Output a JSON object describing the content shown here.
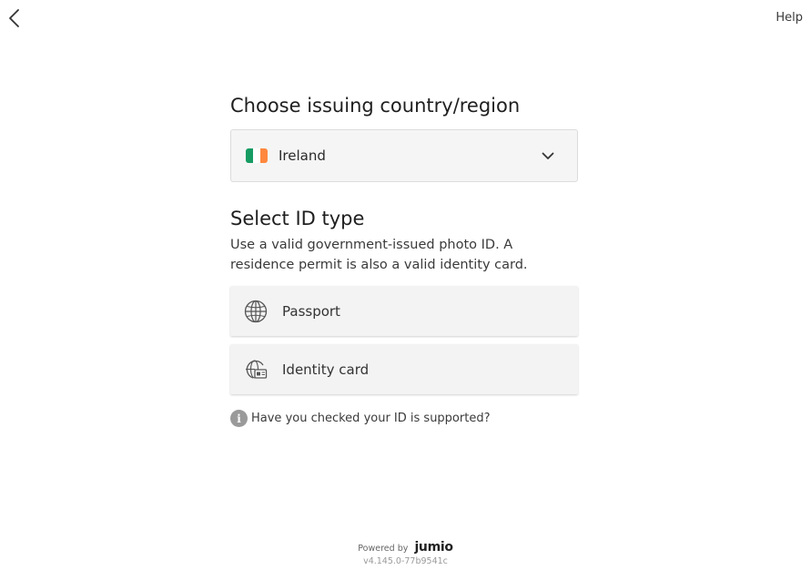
{
  "header": {
    "help_label": "Help"
  },
  "country": {
    "title": "Choose issuing country/region",
    "selected": "Ireland",
    "flag_colors": [
      "#169b62",
      "#ffffff",
      "#ff883e"
    ]
  },
  "id_type": {
    "title": "Select ID type",
    "description": "Use a valid government-issued photo ID. A residence permit is also a valid identity card.",
    "options": [
      {
        "label": "Passport",
        "icon": "globe-icon"
      },
      {
        "label": "Identity card",
        "icon": "id-card-icon"
      }
    ]
  },
  "support": {
    "text": "Have you checked your ID is supported?"
  },
  "footer": {
    "powered_by": "Powered by",
    "brand": "jumio",
    "version": "v4.145.0-77b9541c"
  }
}
